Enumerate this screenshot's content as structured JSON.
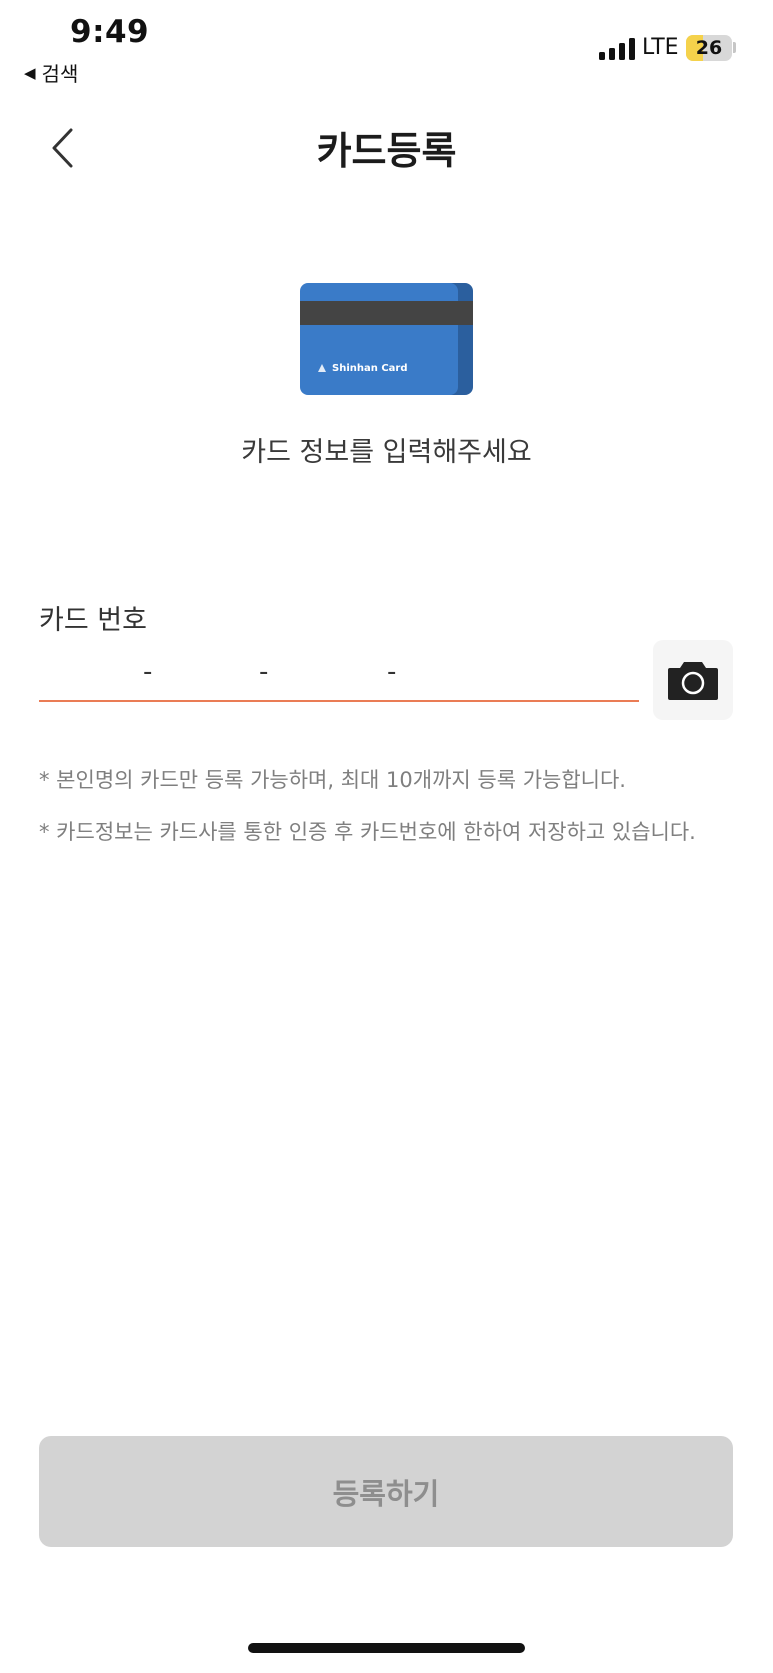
{
  "status_bar": {
    "time": "9:49",
    "back_app_label": "검색",
    "network": "LTE",
    "battery_level": "26",
    "battery_fraction": 0.26
  },
  "header": {
    "title": "카드등록",
    "back_icon": "chevron-left-icon"
  },
  "card_graphic": {
    "brand_text": "Shinhan Card",
    "colors": {
      "card_front": "#3a7bc8",
      "card_back": "#2b5f9e",
      "stripe": "#444444"
    }
  },
  "intro_text": "카드 정보를 입력해주세요",
  "card_number": {
    "label": "카드 번호",
    "separator": "-",
    "camera_icon": "camera-icon"
  },
  "notes": [
    "* 본인명의 카드만 등록 가능하며, 최대 10개까지 등록 가능합니다.",
    "* 카드정보는 카드사를 통한 인증 후 카드번호에 한하여 저장하고 있습니다."
  ],
  "submit_label": "등록하기",
  "colors": {
    "accent_underline": "#ea7c55",
    "button_disabled_bg": "#d3d3d3",
    "button_disabled_text": "#8e8e8e"
  }
}
